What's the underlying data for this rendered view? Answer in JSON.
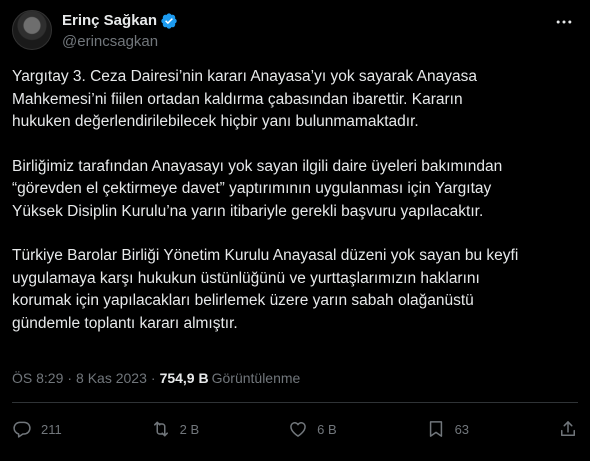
{
  "author": {
    "display_name": "Erinç Sağkan",
    "handle": "@erincsagkan"
  },
  "tweet": {
    "paragraphs": [
      [
        "Yargıtay 3. Ceza Dairesi’nin kararı Anayasa’yı yok sayarak Anayasa",
        "Mahkemesi’ni fiilen ortadan kaldırma çabasından ibarettir. Kararın",
        "hukuken değerlendirilebilecek hiçbir yanı bulunmamaktadır."
      ],
      [
        "Birliğimiz tarafından Anayasayı yok sayan ilgili daire üyeleri bakımından",
        "“görevden el çektirmeye davet” yaptırımının uygulanması için Yargıtay",
        "Yüksek Disiplin Kurulu’na yarın itibariyle gerekli başvuru yapılacaktır."
      ],
      [
        "Türkiye Barolar Birliği Yönetim Kurulu Anayasal düzeni yok sayan bu keyfi",
        "uygulamaya karşı hukukun üstünlüğünü ve yurttaşlarımızın haklarını",
        "korumak için yapılacakları belirlemek üzere yarın sabah olağanüstü",
        "gündemle toplantı kararı almıştır."
      ]
    ]
  },
  "meta": {
    "time": "ÖS 8:29",
    "separator": "·",
    "date": "8 Kas 2023",
    "views_count": "754,9 B",
    "views_label": "Görüntülenme"
  },
  "actions": {
    "replies": "211",
    "retweets": "2 B",
    "likes": "6 B",
    "bookmarks": "63"
  },
  "colors": {
    "background": "#000000",
    "text": "#e7e9ea",
    "muted": "#71767b",
    "verified": "#1d9bf0"
  }
}
